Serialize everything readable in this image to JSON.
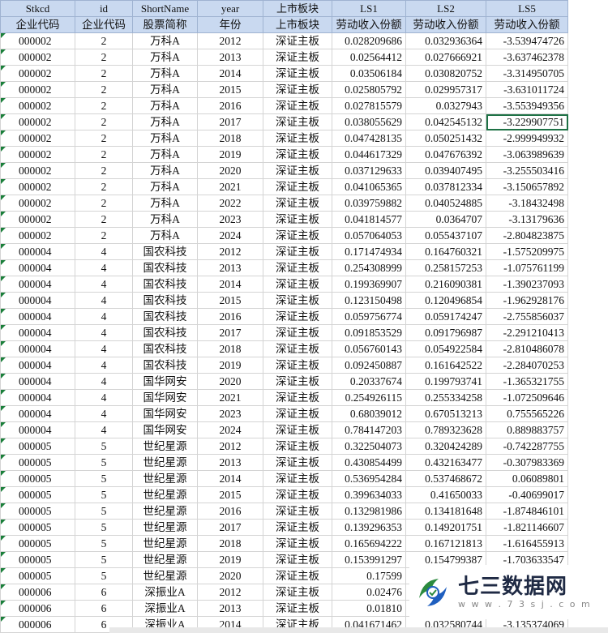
{
  "headers": {
    "row1": [
      "Stkcd",
      "id",
      "ShortName",
      "year",
      "上市板块",
      "LS1",
      "LS2",
      "LS5"
    ],
    "row2": [
      "企业代码",
      "企业代码",
      "股票简称",
      "年份",
      "上市板块",
      "劳动收入份额",
      "劳动收入份额",
      "劳动收入份额"
    ]
  },
  "rows": [
    [
      "000002",
      "2",
      "万科A",
      "2012",
      "深证主板",
      "0.028209686",
      "0.032936364",
      "-3.539474726"
    ],
    [
      "000002",
      "2",
      "万科A",
      "2013",
      "深证主板",
      "0.02564412",
      "0.027666921",
      "-3.637462378"
    ],
    [
      "000002",
      "2",
      "万科A",
      "2014",
      "深证主板",
      "0.03506184",
      "0.030820752",
      "-3.314950705"
    ],
    [
      "000002",
      "2",
      "万科A",
      "2015",
      "深证主板",
      "0.025805792",
      "0.029957317",
      "-3.631011724"
    ],
    [
      "000002",
      "2",
      "万科A",
      "2016",
      "深证主板",
      "0.027815579",
      "0.0327943",
      "-3.553949356"
    ],
    [
      "000002",
      "2",
      "万科A",
      "2017",
      "深证主板",
      "0.038055629",
      "0.042545132",
      "-3.229907751"
    ],
    [
      "000002",
      "2",
      "万科A",
      "2018",
      "深证主板",
      "0.047428135",
      "0.050251432",
      "-2.999949932"
    ],
    [
      "000002",
      "2",
      "万科A",
      "2019",
      "深证主板",
      "0.044617329",
      "0.047676392",
      "-3.063989639"
    ],
    [
      "000002",
      "2",
      "万科A",
      "2020",
      "深证主板",
      "0.037129633",
      "0.039407495",
      "-3.255503416"
    ],
    [
      "000002",
      "2",
      "万科A",
      "2021",
      "深证主板",
      "0.041065365",
      "0.037812334",
      "-3.150657892"
    ],
    [
      "000002",
      "2",
      "万科A",
      "2022",
      "深证主板",
      "0.039759882",
      "0.040524885",
      "-3.18432498"
    ],
    [
      "000002",
      "2",
      "万科A",
      "2023",
      "深证主板",
      "0.041814577",
      "0.0364707",
      "-3.13179636"
    ],
    [
      "000002",
      "2",
      "万科A",
      "2024",
      "深证主板",
      "0.057064053",
      "0.055437107",
      "-2.804823875"
    ],
    [
      "000004",
      "4",
      "国农科技",
      "2012",
      "深证主板",
      "0.171474934",
      "0.164760321",
      "-1.575209975"
    ],
    [
      "000004",
      "4",
      "国农科技",
      "2013",
      "深证主板",
      "0.254308999",
      "0.258157253",
      "-1.075761199"
    ],
    [
      "000004",
      "4",
      "国农科技",
      "2014",
      "深证主板",
      "0.199369907",
      "0.216090381",
      "-1.390237093"
    ],
    [
      "000004",
      "4",
      "国农科技",
      "2015",
      "深证主板",
      "0.123150498",
      "0.120496854",
      "-1.962928176"
    ],
    [
      "000004",
      "4",
      "国农科技",
      "2016",
      "深证主板",
      "0.059756774",
      "0.059174247",
      "-2.755856037"
    ],
    [
      "000004",
      "4",
      "国农科技",
      "2017",
      "深证主板",
      "0.091853529",
      "0.091796987",
      "-2.291210413"
    ],
    [
      "000004",
      "4",
      "国农科技",
      "2018",
      "深证主板",
      "0.056760143",
      "0.054922584",
      "-2.810486078"
    ],
    [
      "000004",
      "4",
      "国农科技",
      "2019",
      "深证主板",
      "0.092450887",
      "0.161642522",
      "-2.284070253"
    ],
    [
      "000004",
      "4",
      "国华网安",
      "2020",
      "深证主板",
      "0.20337674",
      "0.199793741",
      "-1.365321755"
    ],
    [
      "000004",
      "4",
      "国华网安",
      "2021",
      "深证主板",
      "0.254926115",
      "0.255334258",
      "-1.072509646"
    ],
    [
      "000004",
      "4",
      "国华网安",
      "2023",
      "深证主板",
      "0.68039012",
      "0.670513213",
      "0.755565226"
    ],
    [
      "000004",
      "4",
      "国华网安",
      "2024",
      "深证主板",
      "0.784147203",
      "0.789323628",
      "0.889883757"
    ],
    [
      "000005",
      "5",
      "世纪星源",
      "2012",
      "深证主板",
      "0.322504073",
      "0.320424289",
      "-0.742287755"
    ],
    [
      "000005",
      "5",
      "世纪星源",
      "2013",
      "深证主板",
      "0.430854499",
      "0.432163477",
      "-0.307983369"
    ],
    [
      "000005",
      "5",
      "世纪星源",
      "2014",
      "深证主板",
      "0.536954284",
      "0.537468672",
      "0.06089801"
    ],
    [
      "000005",
      "5",
      "世纪星源",
      "2015",
      "深证主板",
      "0.399634033",
      "0.41650033",
      "-0.40699017"
    ],
    [
      "000005",
      "5",
      "世纪星源",
      "2016",
      "深证主板",
      "0.132981986",
      "0.134181648",
      "-1.874846101"
    ],
    [
      "000005",
      "5",
      "世纪星源",
      "2017",
      "深证主板",
      "0.139296353",
      "0.149201751",
      "-1.821146607"
    ],
    [
      "000005",
      "5",
      "世纪星源",
      "2018",
      "深证主板",
      "0.165694222",
      "0.167121813",
      "-1.616455913"
    ],
    [
      "000005",
      "5",
      "世纪星源",
      "2019",
      "深证主板",
      "0.153991297",
      "0.154799387",
      "-1.703633547"
    ],
    [
      "000005",
      "5",
      "世纪星源",
      "2020",
      "深证主板",
      "0.17599",
      "",
      "82"
    ],
    [
      "000006",
      "6",
      "深振业A",
      "2012",
      "深证主板",
      "0.02476",
      "",
      "82"
    ],
    [
      "000006",
      "6",
      "深振业A",
      "2013",
      "深证主板",
      "0.01810",
      "",
      "96"
    ],
    [
      "000006",
      "6",
      "深振业A",
      "2014",
      "深证主板",
      "0.041671462",
      "0.032580744",
      "-3.135374069"
    ]
  ],
  "selected_cell": {
    "row": 5,
    "col": 7
  },
  "watermark": {
    "title": "七三数据网",
    "url": "w w w . 7 3 s j . c o m"
  },
  "colors": {
    "header_bg": "#c9d9f0",
    "selection": "#1e7145",
    "marker": "#1a7f3a"
  }
}
